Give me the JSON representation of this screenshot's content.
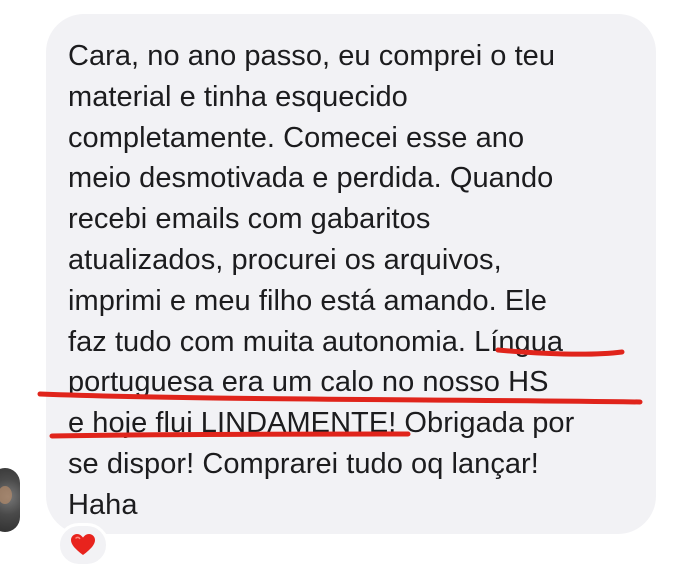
{
  "message": {
    "text": "Cara, no ano passo, eu comprei o teu\nmaterial e tinha esquecido\ncompletamente. Comecei esse ano\nmeio desmotivada e perdida. Quando\nrecebi emails com gabaritos\natualizados, procurei os arquivos,\nimprimi e meu filho está amando. Ele\nfaz tudo com muita autonomia. Língua\nportuguesa era um calo no nosso HS\ne hoje flui LINDAMENTE! Obrigada por\nse dispor! Comprarei tudo oq lançar!\nHaha"
  },
  "reaction": {
    "icon": "heart-icon",
    "color": "#e8231d"
  },
  "annotation": {
    "color": "#e0241b"
  },
  "colors": {
    "bubble": "#f2f2f5",
    "text": "#1c1c1e"
  }
}
